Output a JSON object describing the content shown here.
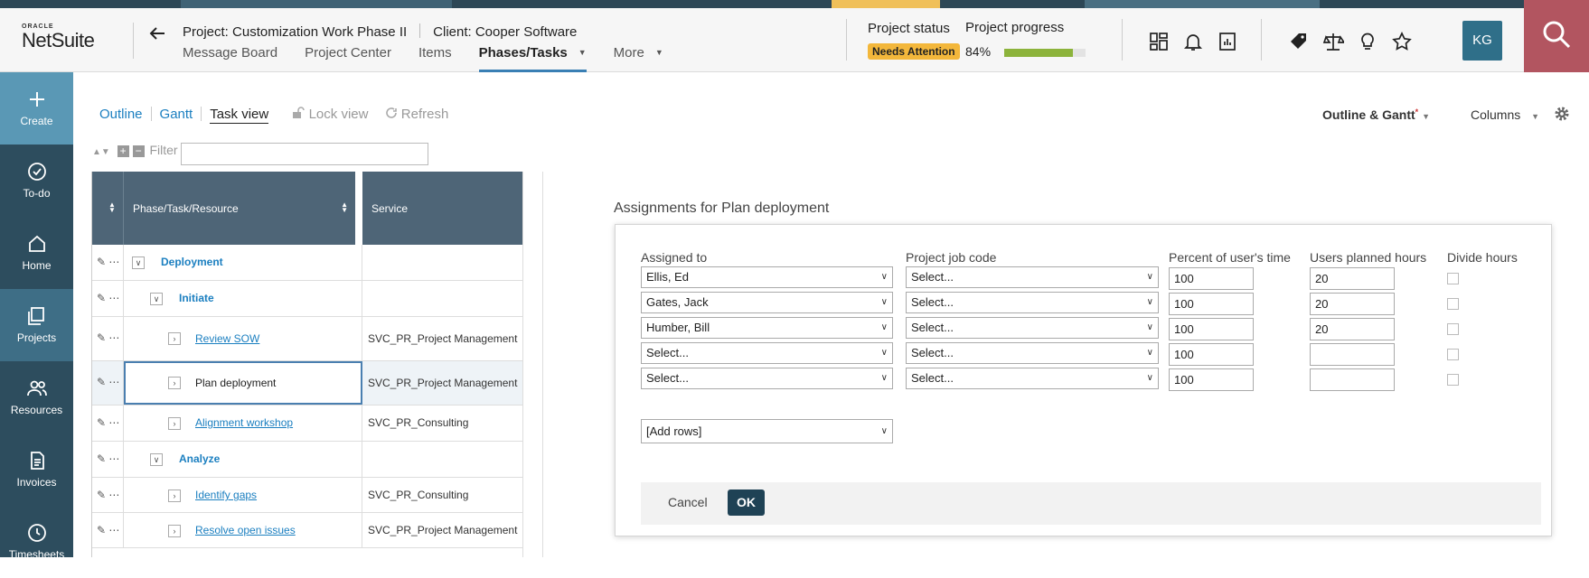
{
  "app": {
    "logo_oracle": "ORACLE",
    "logo_product": "NetSuite",
    "colors": {
      "sidebar": "#2d4d5e",
      "accent": "#1b7fc0",
      "status_badge": "#f3b73b",
      "progress": "#8cb33b",
      "search_bg": "#b25560"
    }
  },
  "header": {
    "project_title": "Project: Customization Work Phase II",
    "client": "Client: Cooper Software",
    "nav": [
      {
        "label": "Message Board"
      },
      {
        "label": "Project Center"
      },
      {
        "label": "Items"
      },
      {
        "label": "Phases/Tasks",
        "active": true
      },
      {
        "label": "More"
      }
    ],
    "status_label": "Project status",
    "progress_label": "Project progress",
    "status_value": "Needs Attention",
    "progress_value": "84%",
    "progress_fraction": 0.84,
    "avatar_initials": "KG",
    "icons": [
      "dashboard-icon",
      "bell-icon",
      "report-icon",
      "tag-icon",
      "scale-icon",
      "bulb-icon",
      "star-icon",
      "search-icon"
    ]
  },
  "sidebar": {
    "items": [
      {
        "label": "Create",
        "icon": "plus-icon"
      },
      {
        "label": "To-do",
        "icon": "check-circle-icon"
      },
      {
        "label": "Home",
        "icon": "home-icon"
      },
      {
        "label": "Projects",
        "icon": "projects-icon"
      },
      {
        "label": "Resources",
        "icon": "people-icon"
      },
      {
        "label": "Invoices",
        "icon": "invoice-icon"
      },
      {
        "label": "Timesheets",
        "icon": "clock-icon"
      }
    ]
  },
  "toolbar": {
    "tabs": [
      "Outline",
      "Gantt",
      "Task view"
    ],
    "lock_view": "Lock view",
    "refresh": "Refresh",
    "view_select": "Outline & Gantt",
    "columns": "Columns",
    "filter_label": "Filter",
    "filter_value": ""
  },
  "grid": {
    "headers": [
      "Phase/Task/Resource",
      "Service"
    ],
    "rows": [
      {
        "name": "Deployment",
        "service": "",
        "level": 0,
        "type": "phase"
      },
      {
        "name": "Initiate",
        "service": "",
        "level": 1,
        "type": "phase"
      },
      {
        "name": "Review SOW",
        "service": "SVC_PR_Project Management",
        "level": 2,
        "type": "task"
      },
      {
        "name": "Plan deployment",
        "service": "SVC_PR_Project Management",
        "level": 2,
        "type": "task",
        "selected": true
      },
      {
        "name": "Alignment workshop",
        "service": "SVC_PR_Consulting",
        "level": 2,
        "type": "task"
      },
      {
        "name": "Analyze",
        "service": "",
        "level": 1,
        "type": "phase"
      },
      {
        "name": "Identify gaps",
        "service": "SVC_PR_Consulting",
        "level": 2,
        "type": "task"
      },
      {
        "name": "Resolve open issues",
        "service": "SVC_PR_Project Management",
        "level": 2,
        "type": "task"
      }
    ]
  },
  "dialog": {
    "title": "Assignments for Plan deployment",
    "columns": [
      "Assigned to",
      "Project job code",
      "Percent of user's time",
      "Users planned hours",
      "Divide hours"
    ],
    "rows": [
      {
        "assigned": "Ellis, Ed",
        "job_code": "Select...",
        "percent": "100",
        "hours": "20"
      },
      {
        "assigned": "Gates, Jack",
        "job_code": "Select...",
        "percent": "100",
        "hours": "20"
      },
      {
        "assigned": "Humber, Bill",
        "job_code": "Select...",
        "percent": "100",
        "hours": "20"
      },
      {
        "assigned": "Select...",
        "job_code": "Select...",
        "percent": "100",
        "hours": ""
      },
      {
        "assigned": "Select...",
        "job_code": "Select...",
        "percent": "100",
        "hours": ""
      }
    ],
    "add_rows": "[Add rows]",
    "cancel": "Cancel",
    "ok": "OK"
  }
}
